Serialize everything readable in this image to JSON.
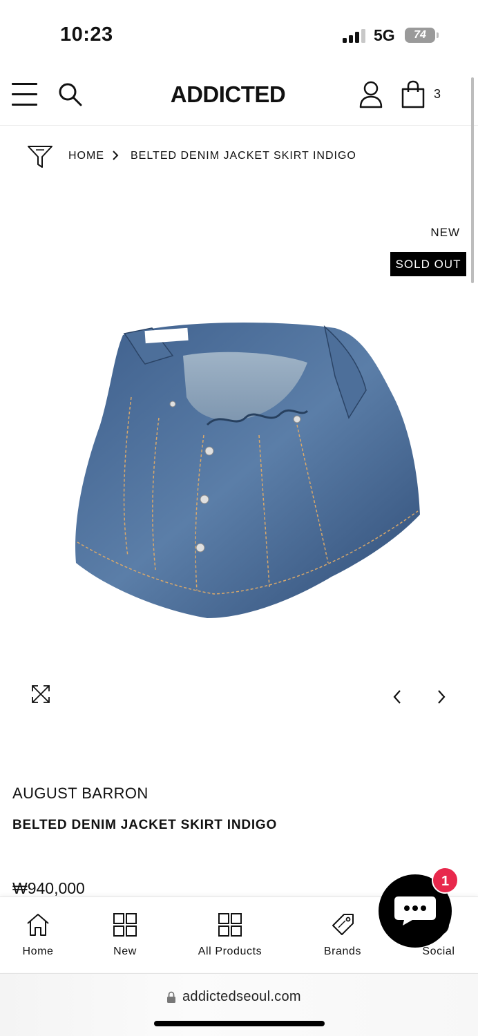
{
  "status_bar": {
    "time": "10:23",
    "network": "5G",
    "battery": "74"
  },
  "header": {
    "logo": "ADDICTED",
    "cart_count": "3"
  },
  "breadcrumb": {
    "home": "HOME",
    "current": "BELTED DENIM JACKET SKIRT INDIGO"
  },
  "badges": {
    "new": "NEW",
    "sold_out": "SOLD OUT"
  },
  "product": {
    "brand": "AUGUST BARRON",
    "title": "BELTED DENIM JACKET SKIRT INDIGO",
    "price": "₩940,000",
    "image_icon": "denim-jacket-skirt-image"
  },
  "bottom_nav": {
    "items": [
      {
        "label": "Home",
        "icon": "home-icon"
      },
      {
        "label": "New",
        "icon": "grid-icon"
      },
      {
        "label": "All Products",
        "icon": "grid-icon"
      },
      {
        "label": "Brands",
        "icon": "tag-icon"
      },
      {
        "label": "Social",
        "icon": "social-icon"
      }
    ]
  },
  "chat": {
    "unread": "1"
  },
  "browser": {
    "url": "addictedseoul.com"
  },
  "colors": {
    "accent_badge": "#e8284c",
    "sold_out_bg": "#000000"
  }
}
